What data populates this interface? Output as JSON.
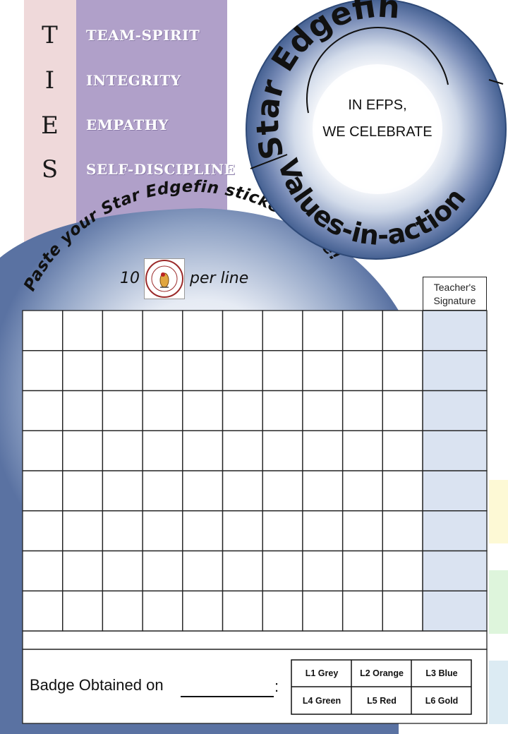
{
  "ties": {
    "letters": [
      "T",
      "I",
      "E",
      "S"
    ],
    "values": [
      "TEAM-SPIRIT",
      "INTEGRITY",
      "EMPATHY",
      "SELF-DISCIPLINE"
    ]
  },
  "seal": {
    "top_text": "Star Edgefin",
    "bottom_text": "Values-in-action",
    "center_line1": "IN EFPS,",
    "center_line2": "WE CELEBRATE"
  },
  "stickers": {
    "arc_title": "Paste your Star Edgefin stickers here!",
    "count": "10",
    "per_line": "per line",
    "logo_text_top": "I am a Star Edgefin",
    "logo_text_bottom": "Edgefield Primary"
  },
  "grid": {
    "columns": 10,
    "rows": 8,
    "signature_header_line1": "Teacher's",
    "signature_header_line2": "Signature"
  },
  "badge": {
    "label": "Badge Obtained on",
    "colon": ":",
    "levels": [
      "L1 Grey",
      "L2 Orange",
      "L3 Blue",
      "L4 Green",
      "L5 Red",
      "L6 Gold"
    ]
  },
  "colors": {
    "ties_bg": "#efd9da",
    "values_bg": "#b0a0c9",
    "seal_blue": "#3d5a8c",
    "signature_col": "#dae3f1",
    "tab_yellow": "#fdf9d5",
    "tab_green": "#def5dc",
    "tab_blue": "#dcebf3"
  }
}
